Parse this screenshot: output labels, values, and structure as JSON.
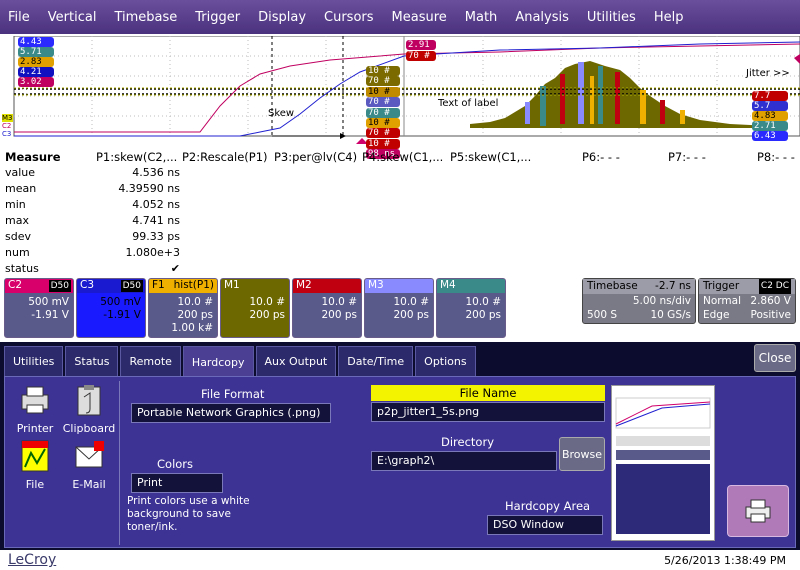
{
  "menu": [
    "File",
    "Vertical",
    "Timebase",
    "Trigger",
    "Display",
    "Cursors",
    "Measure",
    "Math",
    "Analysis",
    "Utilities",
    "Help"
  ],
  "waveform": {
    "left_labels": [
      "4.43 ns",
      "5.71 ns",
      "2.83 ns",
      "4.21 ns",
      "3.02 ns"
    ],
    "left_colors": [
      "#2a2aff",
      "#3b8a8a",
      "#e0a000",
      "#1010c0",
      "#c00060"
    ],
    "mid_labels": [
      "10 #",
      "70 #",
      "10 #",
      "70 #",
      "70 #",
      "10 #",
      "70 #",
      "10 #",
      "98 ns"
    ],
    "mid_colors": [
      "#7a6a00",
      "#7a6a00",
      "#c08a00",
      "#5a5ac0",
      "#3b8a8a",
      "#e0a000",
      "#c00000",
      "#c00000",
      "#c00060"
    ],
    "hist_labels": [
      "2.91 #",
      "70 #"
    ],
    "right_labels": [
      "7.7 ns",
      "5.7 ns",
      "4.83 ns",
      "2.71 ns",
      "6.43 ns"
    ],
    "right_colors": [
      "#c00000",
      "#3030d0",
      "#e0a000",
      "#3b8a8a",
      "#2a2aff"
    ],
    "skew_text": "Skew",
    "label_text": "Text of label",
    "jitter_text": "Jitter >>",
    "side_tags": [
      "M3",
      "C2",
      "C3"
    ]
  },
  "measure": {
    "title": "Measure",
    "params": [
      "P1:skew(C2,...",
      "P2:Rescale(P1)",
      "P3:per@lv(C4)",
      "P4:skew(C1,...",
      "P5:skew(C1,...",
      "P6:- - -",
      "P7:- - -",
      "P8:- - -"
    ],
    "rows": [
      {
        "name": "value",
        "value": "4.536 ns"
      },
      {
        "name": "mean",
        "value": "4.39590 ns"
      },
      {
        "name": "min",
        "value": "4.052 ns"
      },
      {
        "name": "max",
        "value": "4.741 ns"
      },
      {
        "name": "sdev",
        "value": "99.33 ps"
      },
      {
        "name": "num",
        "value": "1.080e+3"
      },
      {
        "name": "status",
        "value": "✔"
      }
    ]
  },
  "descriptors": [
    {
      "name": "C2",
      "tag": "D50",
      "lines": [
        "500 mV",
        "-1.91 V"
      ],
      "hdr": "#d8006a",
      "body": "#5a5a8a",
      "fg": "#fff"
    },
    {
      "name": "C3",
      "tag": "D50",
      "lines": [
        "500 mV",
        "-1.91 V"
      ],
      "hdr": "#1a1ad0",
      "body": "#1a1aff",
      "fg": "#000"
    },
    {
      "name": "F1",
      "extra": "hist(P1)",
      "lines": [
        "10.0 #",
        "200 ps",
        "1.00 k#"
      ],
      "hdr": "#f0b000",
      "body": "#5a5a8a",
      "fg": "#fff",
      "hdrfg": "#000"
    },
    {
      "name": "M1",
      "lines": [
        "10.0 #",
        "200 ps"
      ],
      "hdr": "#6e6800",
      "body": "#6e6800",
      "fg": "#fff"
    },
    {
      "name": "M2",
      "lines": [
        "10.0 #",
        "200 ps"
      ],
      "hdr": "#c00010",
      "body": "#5a5a8a",
      "fg": "#fff"
    },
    {
      "name": "M3",
      "lines": [
        "10.0 #",
        "200 ps"
      ],
      "hdr": "#8a8aff",
      "body": "#5a5a8a",
      "fg": "#fff"
    },
    {
      "name": "M4",
      "lines": [
        "10.0 #",
        "200 ps"
      ],
      "hdr": "#3b8a8a",
      "body": "#5a5a8a",
      "fg": "#fff"
    }
  ],
  "timebase": {
    "label": "Timebase",
    "offset": "-2.7 ns",
    "rows": [
      [
        "",
        "5.00 ns/div"
      ],
      [
        "500 S",
        "10 GS/s"
      ]
    ]
  },
  "trigger": {
    "label": "Trigger",
    "tag": "C2 DC",
    "rows": [
      [
        "Normal",
        "2.860 V"
      ],
      [
        "Edge",
        "Positive"
      ]
    ]
  },
  "dialog": {
    "tabs": [
      "Utilities",
      "Status",
      "Remote",
      "Hardcopy",
      "Aux Output",
      "Date/Time",
      "Options"
    ],
    "active_tab": "Hardcopy",
    "close": "Close",
    "devices": [
      {
        "label": "Printer",
        "icon": "printer-icon"
      },
      {
        "label": "Clipboard",
        "icon": "clipboard-icon"
      },
      {
        "label": "File",
        "icon": "file-icon"
      },
      {
        "label": "E-Mail",
        "icon": "email-icon"
      }
    ],
    "file_format_label": "File Format",
    "file_format_value": "Portable Network Graphics (.png)",
    "colors_label": "Colors",
    "colors_value": "Print",
    "colors_note": "Print colors use a white background to save toner/ink.",
    "file_name_label": "File Name",
    "file_name_value": "p2p_jitter1_5s.png",
    "directory_label": "Directory",
    "directory_value": "E:\\graph2\\",
    "browse": "Browse",
    "area_label": "Hardcopy Area",
    "area_value": "DSO Window",
    "pict_tag": "PICT1"
  },
  "footer": {
    "brand": "LeCroy",
    "datetime": "5/26/2013 1:38:49 PM"
  }
}
